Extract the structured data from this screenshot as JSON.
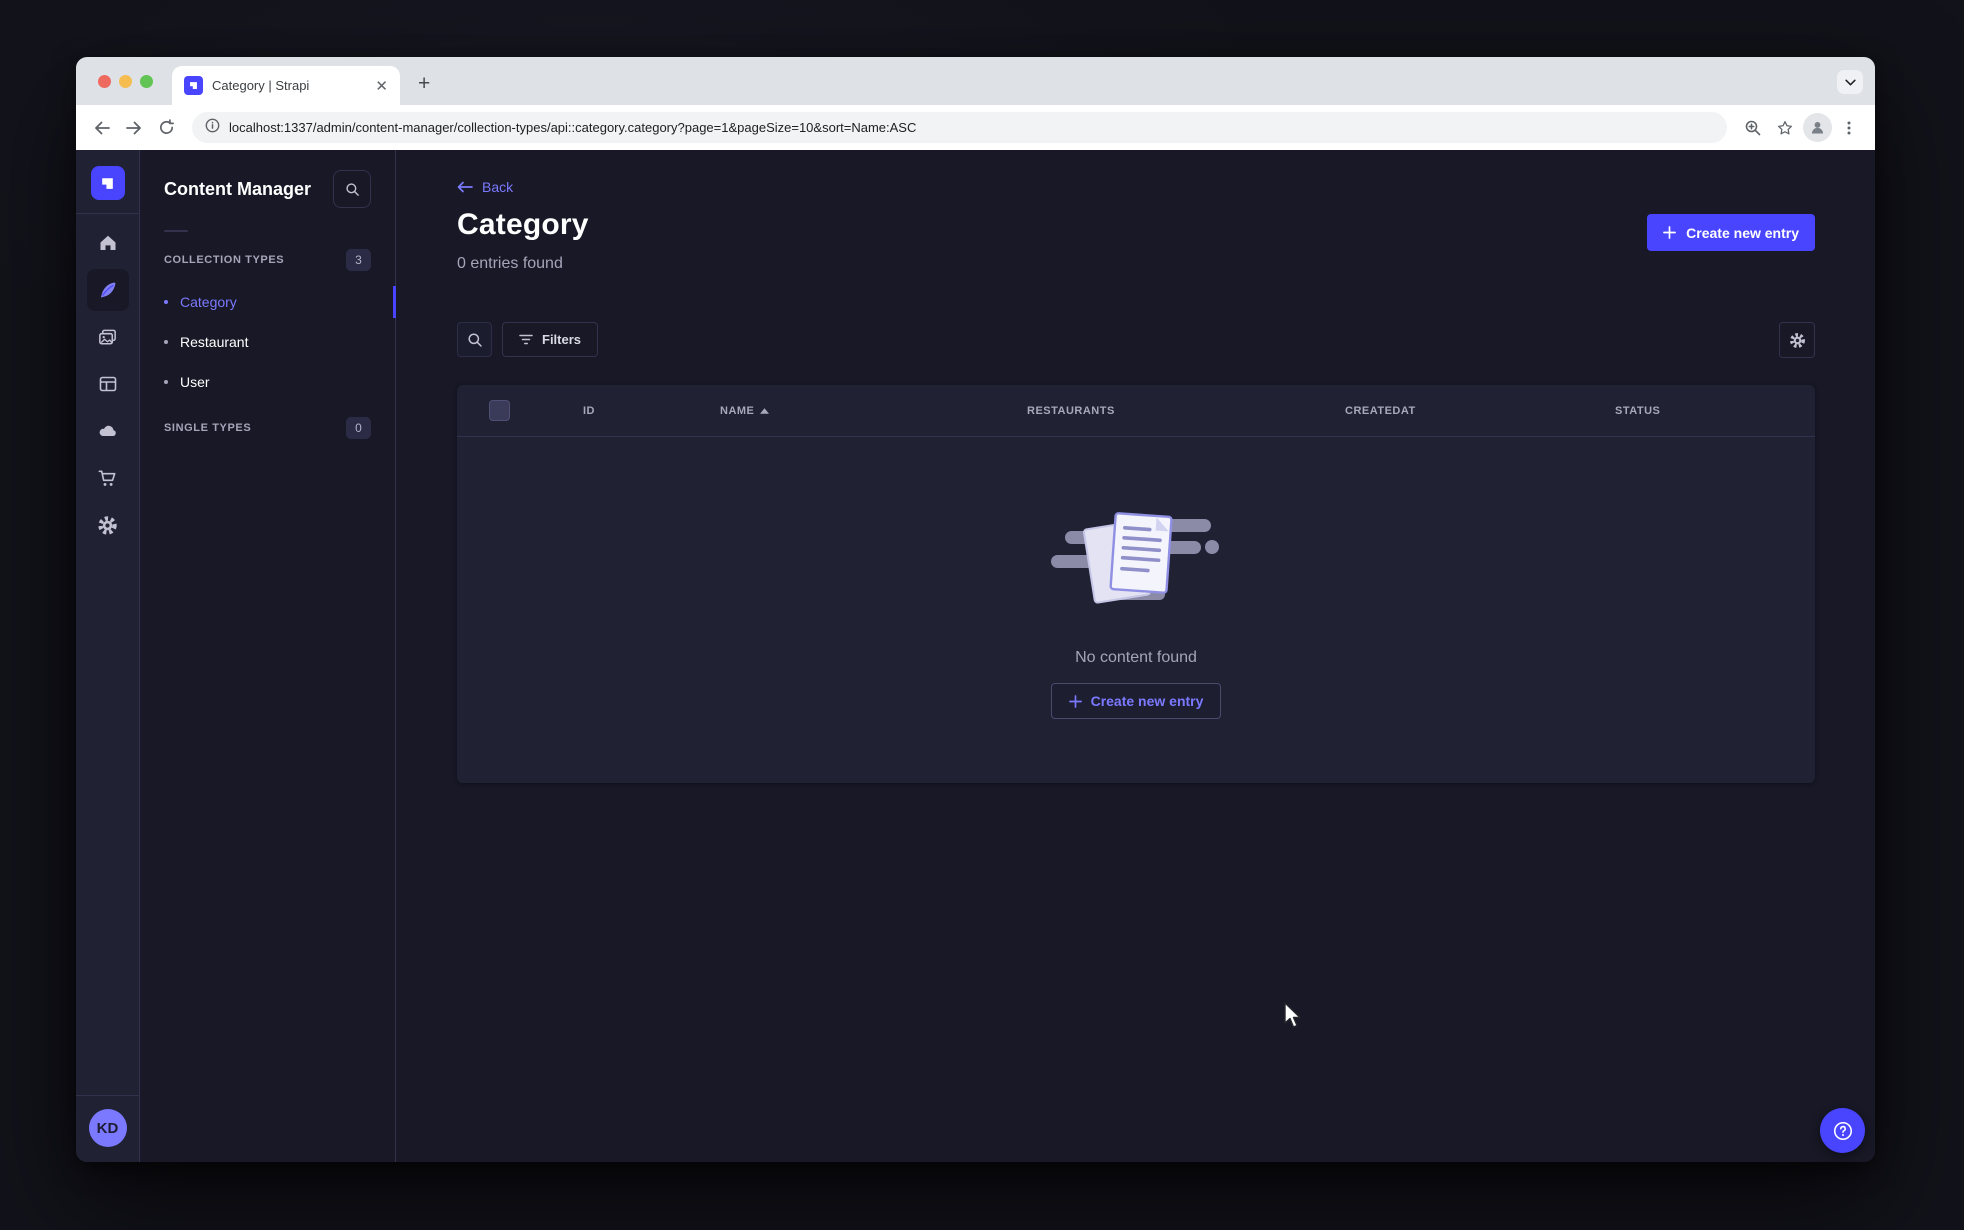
{
  "browser": {
    "tab_title": "Category | Strapi",
    "url": "localhost:1337/admin/content-manager/collection-types/api::category.category?page=1&pageSize=10&sort=Name:ASC"
  },
  "sidebar": {
    "icons": [
      "strapi-logo",
      "home",
      "content-manager-feather",
      "media-library",
      "content-type-builder",
      "cloud",
      "marketplace-cart",
      "settings-gear"
    ],
    "active_icon": "content-manager-feather",
    "avatar_initials": "KD"
  },
  "subnav": {
    "title": "Content Manager",
    "sections": [
      {
        "label": "COLLECTION TYPES",
        "badge": "3",
        "items": [
          {
            "label": "Category",
            "active": true
          },
          {
            "label": "Restaurant",
            "active": false
          },
          {
            "label": "User",
            "active": false
          }
        ]
      },
      {
        "label": "SINGLE TYPES",
        "badge": "0",
        "items": []
      }
    ]
  },
  "main": {
    "back_label": "Back",
    "title": "Category",
    "subtitle": "0 entries found",
    "create_button_label": "Create new entry",
    "filters_button_label": "Filters",
    "table": {
      "columns": [
        "ID",
        "NAME",
        "RESTAURANTS",
        "CREATEDAT",
        "STATUS"
      ],
      "sorted_column": "NAME",
      "sort_direction": "ASC",
      "rows": []
    },
    "empty_state": {
      "message": "No content found",
      "cta_label": "Create new entry"
    }
  },
  "colors": {
    "primary": "#4945ff",
    "primary_light": "#7b79ff",
    "app_background": "#181826",
    "panel_background": "#212134",
    "border": "#32324d",
    "text_muted": "#a5a5ba"
  }
}
